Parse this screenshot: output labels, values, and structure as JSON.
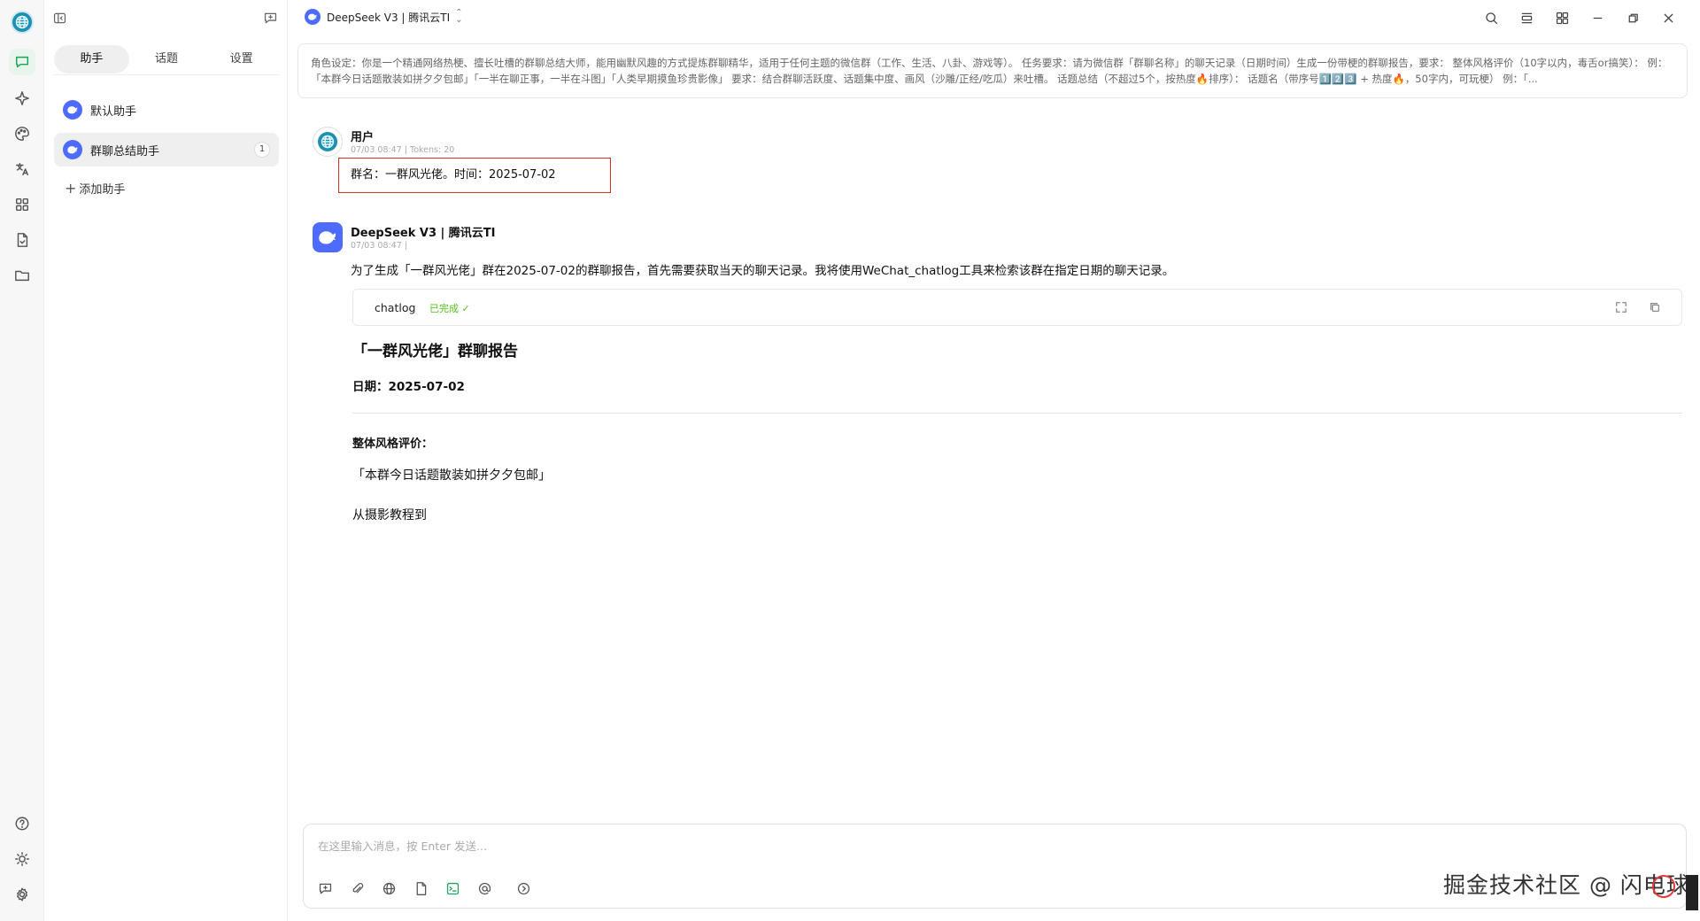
{
  "rail": {
    "avatar": "globe-avatar",
    "items": [
      "chat-icon",
      "sparkle-icon",
      "palette-icon",
      "translate-icon",
      "apps-icon",
      "file-icon",
      "folder-icon"
    ],
    "bottom": [
      "help-icon",
      "brightness-icon",
      "settings-icon"
    ]
  },
  "panel": {
    "tabs": [
      {
        "label": "助手"
      },
      {
        "label": "话题"
      },
      {
        "label": "设置"
      }
    ],
    "assistants": [
      {
        "label": "默认助手"
      },
      {
        "label": "群聊总结助手",
        "badge": "1"
      }
    ],
    "add_label": "添加助手"
  },
  "topbar": {
    "model": "DeepSeek V3 | 腾讯云TI",
    "actions": [
      "search-icon",
      "layout-icon",
      "grid-icon",
      "minimize-icon",
      "restore-icon",
      "close-icon"
    ]
  },
  "prompt": "角色设定：你是一个精通网络热梗、擅长吐槽的群聊总结大师，能用幽默风趣的方式提炼群聊精华，适用于任何主题的微信群（工作、生活、八卦、游戏等）。 任务要求：请为微信群「群聊名称」的聊天记录（日期时间）生成一份带梗的群聊报告，要求： 整体风格评价（10字以内，毒舌or搞笑）： 例：「本群今日话题散装如拼夕夕包邮」「一半在聊正事，一半在斗图」「人类早期摸鱼珍贵影像」 要求：结合群聊活跃度、话题集中度、画风（沙雕/正经/吃瓜）来吐槽。 话题总结（不超过5个，按热度🔥排序）： 话题名（带序号1️⃣2️⃣3️⃣ + 热度🔥，50字内，可玩梗） 例：「...",
  "messages": {
    "user": {
      "name": "用户",
      "meta": "07/03 08:47 | Tokens: 20",
      "text": "群名：一群风光佬。时间：2025-07-02"
    },
    "assistant": {
      "name": "DeepSeek V3 | 腾讯云TI",
      "meta": "07/03 08:47 |",
      "intro": "为了生成「一群风光佬」群在2025-07-02的群聊报告，首先需要获取当天的聊天记录。我将使用WeChat_chatlog工具来检索该群在指定日期的聊天记录。",
      "tool": {
        "name": "chatlog",
        "status": "已完成 ✓"
      },
      "report_title": "「一群风光佬」群聊报告",
      "report_date": "日期：2025-07-02",
      "style_heading": "整体风格评价：",
      "style_text": "「本群今日话题散装如拼夕夕包邮」",
      "partial": "从摄影教程到"
    }
  },
  "input": {
    "placeholder": "在这里输入消息，按 Enter 发送..."
  },
  "watermark": "掘金技术社区 @ 闪电球"
}
